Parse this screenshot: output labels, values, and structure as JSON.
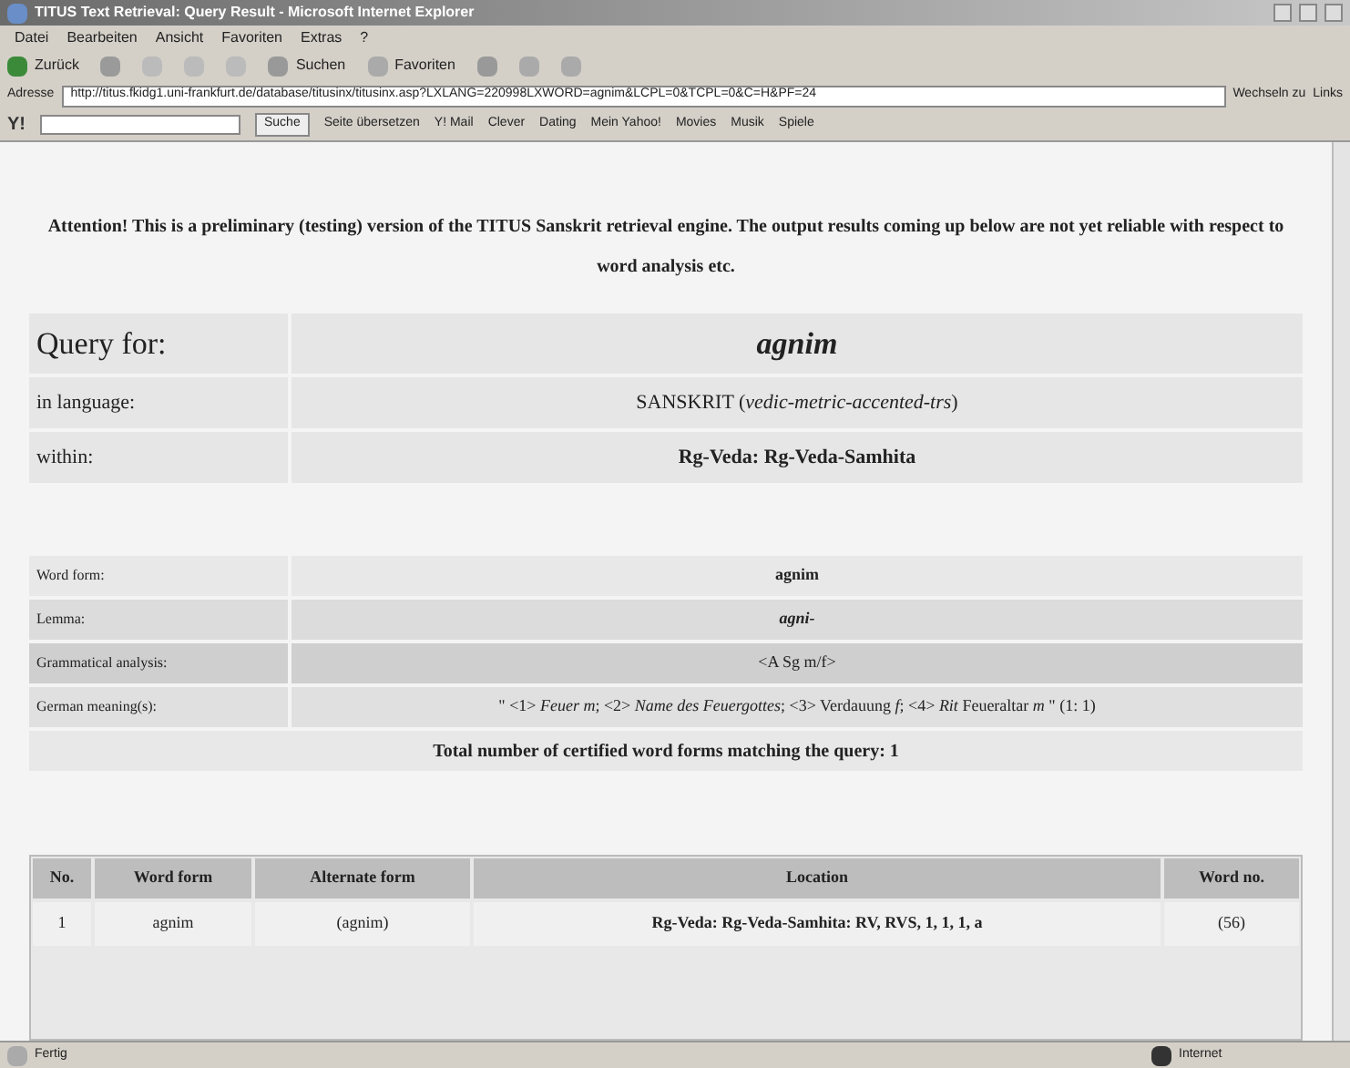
{
  "window": {
    "title": "TITUS Text Retrieval: Query Result - Microsoft Internet Explorer"
  },
  "menu": [
    "Datei",
    "Bearbeiten",
    "Ansicht",
    "Favoriten",
    "Extras",
    "?"
  ],
  "toolbar": {
    "back": "Zurück",
    "search": "Suchen",
    "favorites": "Favoriten"
  },
  "address": {
    "label": "Adresse",
    "url": "http://titus.fkidg1.uni-frankfurt.de/database/titusinx/titusinx.asp?LXLANG=220998LXWORD=agnim&LCPL=0&TCPL=0&C=H&PF=24",
    "go": "Wechseln zu",
    "links": "Links"
  },
  "yahoo_toolbar": {
    "logo": "Y!",
    "search_button": "Suche",
    "items": [
      "Seite übersetzen",
      "Y! Mail",
      "Clever",
      "Dating",
      "Mein Yahoo!",
      "Movies",
      "Musik",
      "Spiele"
    ]
  },
  "notice": "Attention! This is a preliminary (testing) version of the TITUS Sanskrit retrieval engine. The output results coming up below are not yet reliable with respect to word analysis etc.",
  "query": [
    {
      "label": "Query for:",
      "value": "agnim",
      "kind": "title"
    },
    {
      "label": "in language:",
      "value": "SANSKRIT (*vedic-metric-accented-trs*)",
      "kind": "plain"
    },
    {
      "label": "within:",
      "value": "Rg-Veda: Rg-Veda-Samhita",
      "kind": "bold"
    }
  ],
  "analysis": [
    {
      "label": "Word form:",
      "value": "agnim"
    },
    {
      "label": "Lemma:",
      "value": "agni-"
    },
    {
      "label": "Grammatical analysis:",
      "value": "<A Sg m/f>"
    },
    {
      "label": "German meaning(s):",
      "value": "\" <1> *Feuer m*; <2> *Name des Feuergottes*; <3> Verdauung *f*; <4> *Rit* Feueraltar *m* \" (1: 1)"
    }
  ],
  "total": "Total number of certified word forms matching the query: 1",
  "results": {
    "columns": [
      "No.",
      "Word form",
      "Alternate form",
      "Location",
      "Word no."
    ],
    "rows": [
      [
        "1",
        "agnim",
        "(agnim)",
        "Rg-Veda: Rg-Veda-Samhita: RV, RVS, 1, 1, 1, a",
        "(56)"
      ]
    ]
  },
  "status_bar": {
    "text": "Fertig",
    "zone": "Internet"
  }
}
